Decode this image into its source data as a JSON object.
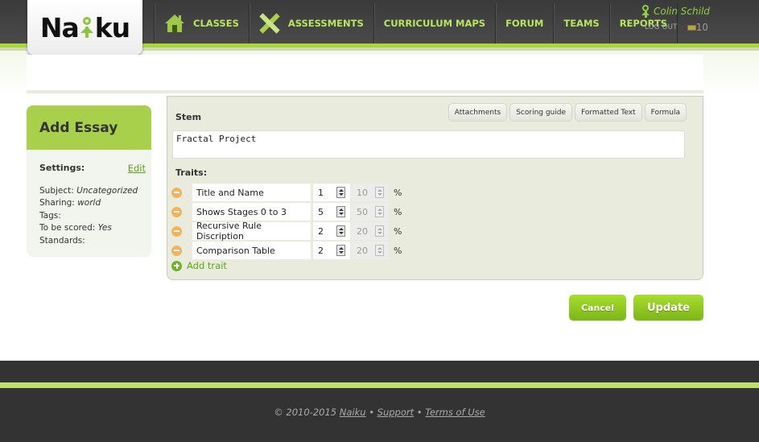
{
  "brand": {
    "logo_text_left": "Na",
    "logo_text_right": "ku",
    "accent": "#a6d838",
    "nav_text_color": "#b9e65a"
  },
  "nav": {
    "items": [
      {
        "label": "CLASSES",
        "icon": "home-icon"
      },
      {
        "label": "ASSESSMENTS",
        "icon": "pencil-ruler-icon"
      },
      {
        "label": "CURRICULUM MAPS",
        "icon": ""
      },
      {
        "label": "FORUM",
        "icon": ""
      },
      {
        "label": "TEAMS",
        "icon": ""
      },
      {
        "label": "REPORTS",
        "icon": ""
      }
    ]
  },
  "user": {
    "name": "Colin Schild",
    "logout": "LOG OUT",
    "message_count": "10"
  },
  "sidebar": {
    "title": "Add Essay",
    "settings_label": "Settings:",
    "edit_label": "Edit",
    "meta": [
      {
        "key": "Subject:",
        "value": "Uncategorized"
      },
      {
        "key": "Sharing:",
        "value": "world"
      },
      {
        "key": "Tags:",
        "value": ""
      },
      {
        "key": "To be scored:",
        "value": "Yes"
      },
      {
        "key": "Standards:",
        "value": ""
      }
    ]
  },
  "editor": {
    "stem_label": "Stem",
    "stem_value": "Fractal Project",
    "tool_buttons": [
      "Attachments",
      "Scoring guide",
      "Formatted Text",
      "Formula"
    ],
    "traits_label": "Traits:",
    "traits": [
      {
        "name": "Title and Name",
        "points": "1",
        "percent": "10"
      },
      {
        "name": "Shows Stages 0 to 3",
        "points": "5",
        "percent": "50"
      },
      {
        "name": "Recursive Rule Discription",
        "points": "2",
        "percent": "20"
      },
      {
        "name": "Comparison Table",
        "points": "2",
        "percent": "20"
      }
    ],
    "percent_symbol": "%",
    "add_trait_label": "Add trait"
  },
  "actions": {
    "cancel": "Cancel",
    "update": "Update"
  },
  "footer": {
    "copyright": "© 2010-2015",
    "naiku_link": "Naiku",
    "separator": "•",
    "support_link": "Support",
    "terms_link": "Terms of Use"
  }
}
